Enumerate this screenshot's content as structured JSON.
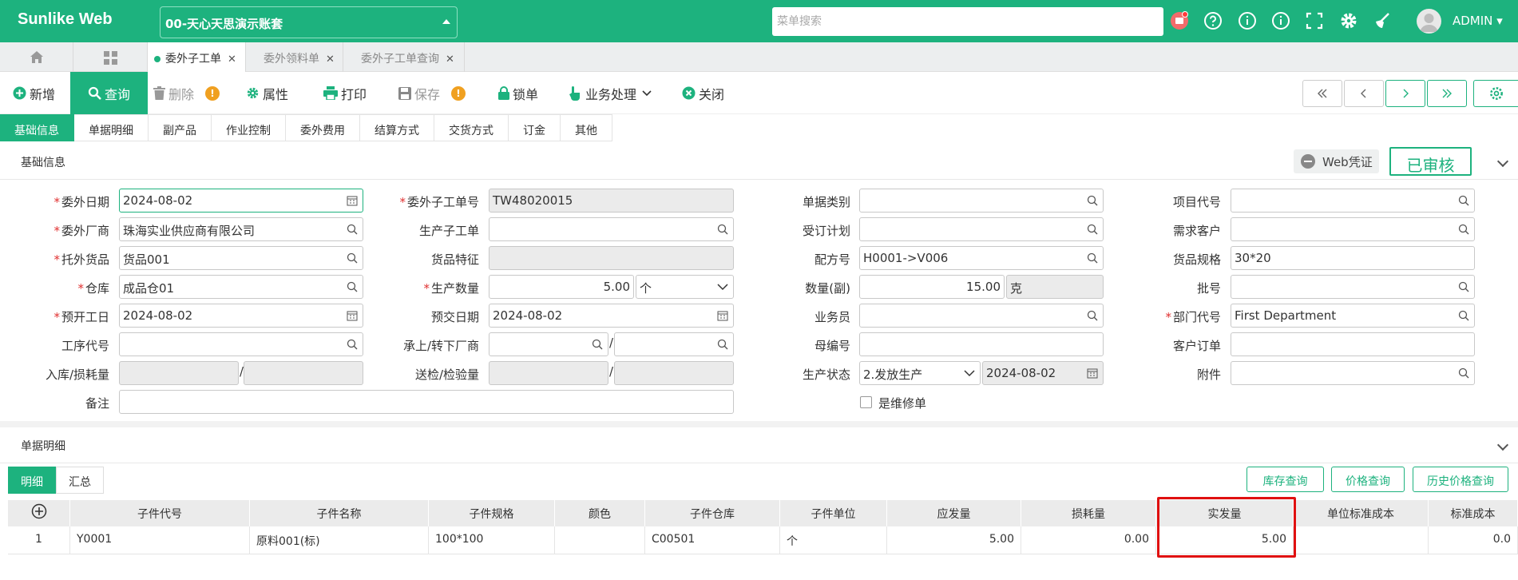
{
  "app": {
    "brand": "Sunlike Web",
    "account": "00-天心天思演示账套",
    "search_placeholder": "菜单搜索",
    "user": "ADMIN"
  },
  "icons": {
    "home": "home-icon",
    "apps": "apps-grid-icon",
    "calendar": "calendar-icon",
    "search": "search-icon",
    "settings": "gear-icon"
  },
  "colors": {
    "brand": "#1db27e",
    "required": "#e03030",
    "highlight": "#e01010",
    "warning": "#f0a020"
  },
  "tabs": [
    {
      "label": "委外子工单",
      "active": true
    },
    {
      "label": "委外领料单",
      "active": false
    },
    {
      "label": "委外子工单查询",
      "active": false
    }
  ],
  "toolbar": {
    "add": "新增",
    "query": "查询",
    "delete": "删除",
    "properties": "属性",
    "print": "打印",
    "save": "保存",
    "lock": "锁单",
    "business": "业务处理",
    "close": "关闭"
  },
  "formtabs": [
    "基础信息",
    "单据明细",
    "副产品",
    "作业控制",
    "委外费用",
    "结算方式",
    "交货方式",
    "订金",
    "其他"
  ],
  "section_basic": {
    "title": "基础信息",
    "web_cert": "Web凭证",
    "status": "已审核"
  },
  "fields": {
    "outsource_date": {
      "label": "委外日期",
      "value": "2024-08-02"
    },
    "outsource_no": {
      "label": "委外子工单号",
      "value": "TW48020015"
    },
    "doc_type": {
      "label": "单据类别",
      "value": ""
    },
    "project_code": {
      "label": "项目代号",
      "value": ""
    },
    "vendor": {
      "label": "委外厂商",
      "value": "珠海实业供应商有限公司"
    },
    "prod_sub_order": {
      "label": "生产子工单",
      "value": ""
    },
    "order_plan": {
      "label": "受订计划",
      "value": ""
    },
    "demand_customer": {
      "label": "需求客户",
      "value": ""
    },
    "goods": {
      "label": "托外货品",
      "value": "货品001"
    },
    "goods_feature": {
      "label": "货品特征",
      "value": ""
    },
    "formula": {
      "label": "配方号",
      "value": "H0001->V006"
    },
    "goods_spec": {
      "label": "货品规格",
      "value": "30*20"
    },
    "warehouse": {
      "label": "仓库",
      "value": "成品仓01"
    },
    "prod_qty": {
      "label": "生产数量",
      "value": "5.00",
      "unit": "个"
    },
    "qty_sub": {
      "label": "数量(副)",
      "value": "15.00",
      "unit": "克"
    },
    "batch": {
      "label": "批号",
      "value": ""
    },
    "plan_start": {
      "label": "预开工日",
      "value": "2024-08-02"
    },
    "plan_delivery": {
      "label": "预交日期",
      "value": "2024-08-02"
    },
    "salesman": {
      "label": "业务员",
      "value": ""
    },
    "dept": {
      "label": "部门代号",
      "value": "First Department"
    },
    "process_code": {
      "label": "工序代号",
      "value": ""
    },
    "upstream_vendor": {
      "label": "承上/转下厂商",
      "value1": "",
      "value2": ""
    },
    "parent_no": {
      "label": "母编号",
      "value": ""
    },
    "customer_order": {
      "label": "客户订单",
      "value": ""
    },
    "stock_loss": {
      "label": "入库/损耗量",
      "value1": "",
      "value2": ""
    },
    "inspect": {
      "label": "送检/检验量",
      "value1": "",
      "value2": ""
    },
    "prod_status": {
      "label": "生产状态",
      "value": "2.发放生产",
      "date": "2024-08-02"
    },
    "attachment": {
      "label": "附件",
      "value": ""
    },
    "remark": {
      "label": "备注",
      "value": ""
    },
    "is_repair": {
      "label": "是维修单",
      "checked": false
    }
  },
  "section_detail": {
    "title": "单据明细"
  },
  "subtabs": [
    "明细",
    "汇总"
  ],
  "grid_buttons": [
    "库存查询",
    "价格查询",
    "历史价格查询"
  ],
  "grid": {
    "columns": [
      "",
      "子件代号",
      "子件名称",
      "子件规格",
      "颜色",
      "子件仓库",
      "子件单位",
      "应发量",
      "损耗量",
      "实发量",
      "单位标准成本",
      "标准成本"
    ],
    "rows": [
      [
        "1",
        "Y0001",
        "原料001(标)",
        "100*100",
        "",
        "C00501",
        "个",
        "5.00",
        "0.00",
        "5.00",
        "",
        "0.0"
      ]
    ]
  }
}
